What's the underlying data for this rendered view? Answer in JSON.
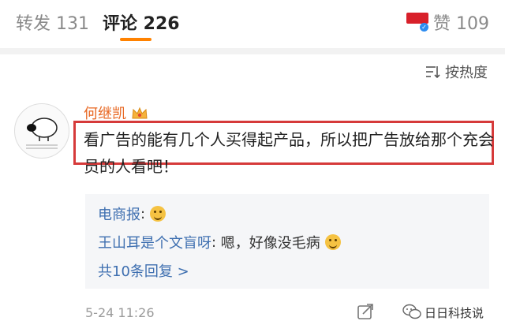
{
  "tabs": {
    "repost": "转发 131",
    "comment": "评论 226",
    "like": "赞 109"
  },
  "sort": {
    "label": "按热度"
  },
  "comment": {
    "username": "何继凯",
    "text": "看广告的能有几个人买得起产品，所以把广告放给那个充会员的人看吧！",
    "date": "5-24 11:26"
  },
  "replies": {
    "items": [
      {
        "user": "电商报",
        "text": ""
      },
      {
        "user": "王山耳是个文盲呀",
        "text": "嗯，好像没毛病"
      }
    ],
    "more": "共10条回复 >"
  },
  "watermark": "日日科技说",
  "icons": {
    "sort": "sort-icon",
    "crown": "crown-icon",
    "share": "share-icon",
    "wechat": "wechat-icon",
    "brand": "brand-badge-icon"
  },
  "colors": {
    "accent": "#ff8200",
    "username": "#e86722",
    "link": "#3e6fb0",
    "highlight": "#d63a3a"
  }
}
